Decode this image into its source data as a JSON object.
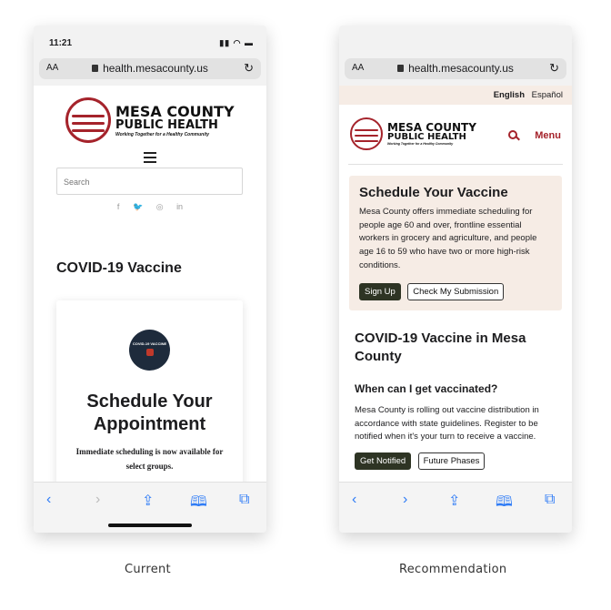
{
  "current": {
    "status_time": "11:21",
    "url": "health.mesacounty.us",
    "aa_label": "AA",
    "logo": {
      "line1": "MESA COUNTY",
      "line2": "PUBLIC HEALTH",
      "tagline": "Working Together for a Healthy Community"
    },
    "search_placeholder": "Search",
    "social": [
      "f",
      "t",
      "ig",
      "in"
    ],
    "heading": "COVID-19 Vaccine",
    "badge_text": "COVID-19 VACCINE",
    "card_title": "Schedule Your Appointment",
    "card_body": "Immediate scheduling is now available for select groups."
  },
  "recommendation": {
    "status_time": "",
    "url": "health.mesacounty.us",
    "aa_label": "AA",
    "languages": {
      "english": "English",
      "spanish": "Español"
    },
    "logo": {
      "line1": "MESA COUNTY",
      "line2": "PUBLIC HEALTH",
      "tagline": "Working Together for a Healthy Community"
    },
    "menu_label": "Menu",
    "panel": {
      "title": "Schedule Your Vaccine",
      "body": "Mesa County offers immediate scheduling for people age 60 and over, frontline essential workers in grocery and agriculture, and people age 16 to 59 who have two or more high-risk conditions.",
      "primary_button": "Sign Up",
      "secondary_button": "Check My Submission"
    },
    "heading": "COVID-19 Vaccine in Mesa County",
    "subheading": "When can I get vaccinated?",
    "paragraph": "Mesa County is rolling out vaccine distribution in accordance with state guidelines. Register to be notified when it's your turn to receive a vaccine.",
    "primary_button": "Get Notified",
    "secondary_button": "Future Phases"
  },
  "toolbar_icons": [
    "back-icon",
    "forward-icon",
    "share-icon",
    "bookmarks-icon",
    "tabs-icon"
  ],
  "captions": {
    "current": "Current",
    "recommendation": "Recommendation"
  },
  "colors": {
    "brand_red": "#a5232b",
    "panel_bg": "#f6ece5",
    "button_dark": "#2e3424",
    "ios_blue": "#2f7cf6"
  }
}
